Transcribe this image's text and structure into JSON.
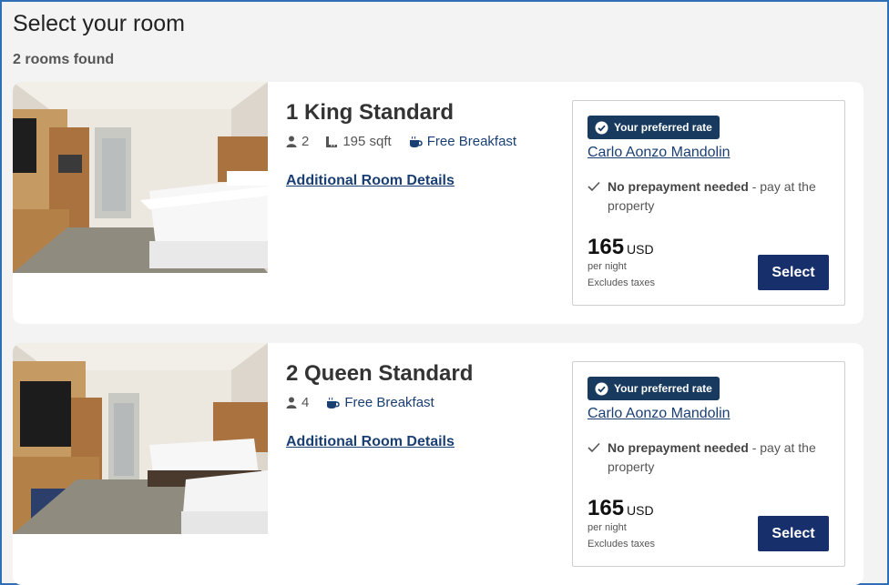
{
  "page": {
    "title": "Select your room",
    "rooms_found": "2 rooms found"
  },
  "rooms": [
    {
      "name": "1 King Standard",
      "guests": "2",
      "size": "195 sqft",
      "amenity": "Free Breakfast",
      "details_link": "Additional Room Details",
      "rate": {
        "badge": "Your preferred rate",
        "plan_name": "Carlo Aonzo Mandolin",
        "prepay_bold": "No prepayment needed",
        "prepay_rest": " - pay at the property",
        "price": "165",
        "currency": "USD",
        "per_night": "per night",
        "taxes": "Excludes taxes",
        "select_label": "Select"
      }
    },
    {
      "name": "2 Queen Standard",
      "guests": "4",
      "amenity": "Free Breakfast",
      "details_link": "Additional Room Details",
      "rate": {
        "badge": "Your preferred rate",
        "plan_name": "Carlo Aonzo Mandolin",
        "prepay_bold": "No prepayment needed",
        "prepay_rest": " - pay at the property",
        "price": "165",
        "currency": "USD",
        "per_night": "per night",
        "taxes": "Excludes taxes",
        "select_label": "Select"
      }
    }
  ],
  "icons": {
    "guests": "person-icon",
    "size": "ruler-icon",
    "breakfast": "coffee-cup-icon",
    "badge": "check-circle-icon",
    "prepay": "checkmark-icon"
  },
  "colors": {
    "brand_navy": "#17306b",
    "badge_bg": "#173a5e",
    "link": "#1a3f73"
  }
}
